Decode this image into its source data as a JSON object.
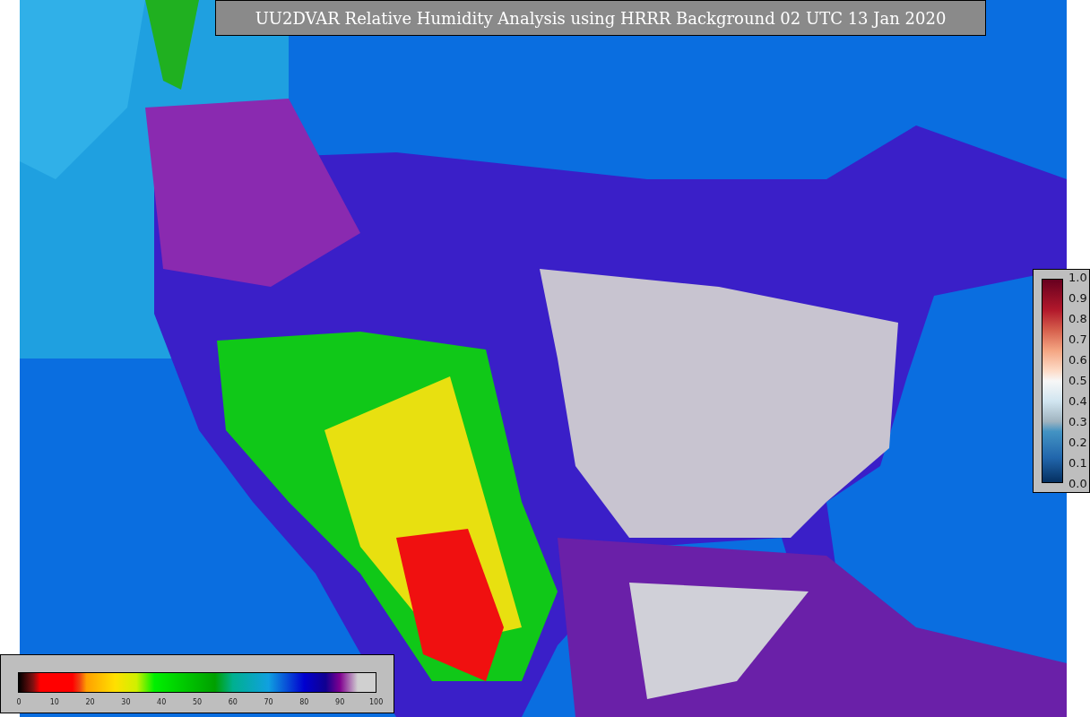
{
  "title": "UU2DVAR Relative Humidity Analysis using HRRR Background 02 UTC 13 Jan 2020",
  "humidity_colorbar": {
    "ticks": [
      "0",
      "10",
      "20",
      "30",
      "40",
      "50",
      "60",
      "70",
      "80",
      "90",
      "100"
    ]
  },
  "station_colorbar": {
    "ticks": [
      "1.0",
      "0.9",
      "0.8",
      "0.7",
      "0.6",
      "0.5",
      "0.4",
      "0.3",
      "0.2",
      "0.1",
      "0.0"
    ]
  }
}
